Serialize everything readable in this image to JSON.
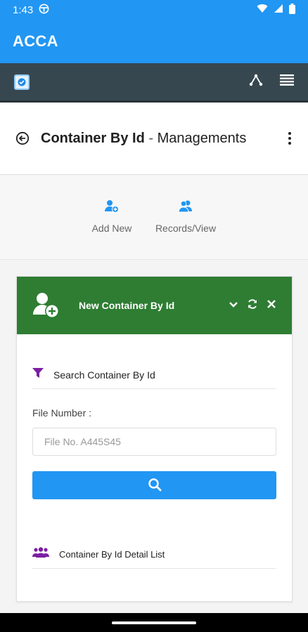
{
  "status_bar": {
    "time": "1:43"
  },
  "app_bar": {
    "title": "ACCA"
  },
  "page": {
    "title_main": "Container By Id",
    "title_separator": " - ",
    "title_sub": "Managements"
  },
  "actions": [
    {
      "label": "Add New",
      "icon": "add-user-icon"
    },
    {
      "label": "Records/View",
      "icon": "users-icon"
    }
  ],
  "card": {
    "title": "New Container By Id",
    "search_section": {
      "label": "Search Container By Id",
      "icon": "filter-icon"
    },
    "file_number_label": "File Number :",
    "file_number_input": {
      "value": "",
      "placeholder": "File No. A445S45"
    },
    "detail_section": {
      "label": "Container By Id Detail List",
      "icon": "users-icon"
    }
  },
  "colors": {
    "primary": "#2196f3",
    "toolbar": "#37474f",
    "card_header": "#2e7d32",
    "section_icon": "#7b1fa2"
  }
}
